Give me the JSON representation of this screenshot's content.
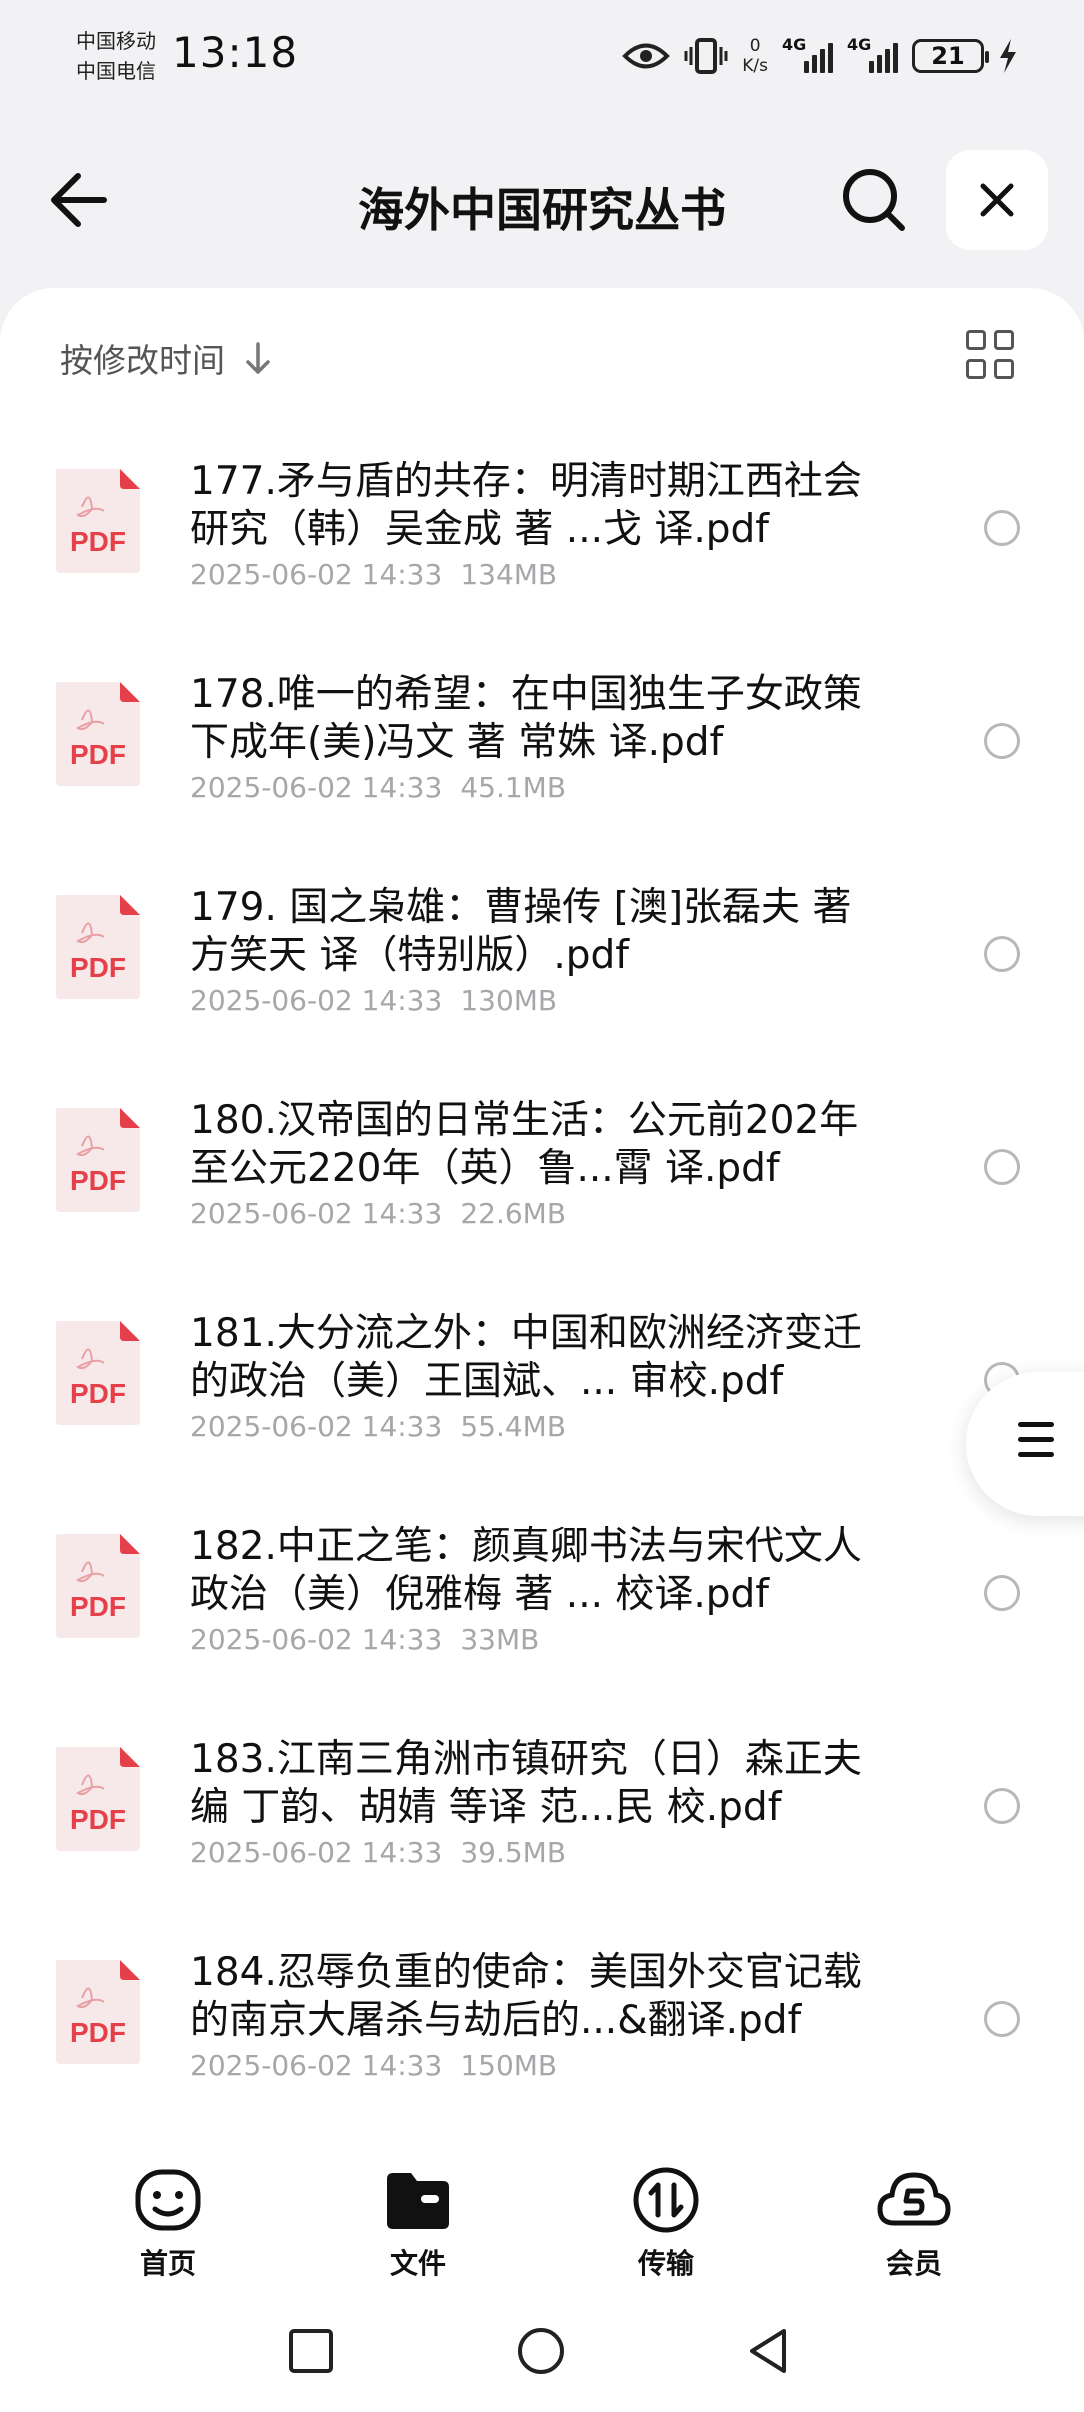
{
  "status_bar": {
    "carrier_1": "中国移动",
    "carrier_2": "中国电信",
    "time": "13:18",
    "net_speed_value": "0",
    "net_speed_unit": "K/s",
    "signal_1": "4G",
    "signal_2": "4G",
    "battery": "21"
  },
  "header": {
    "title": "海外中国研究丛书"
  },
  "sort": {
    "label": "按修改时间"
  },
  "files": [
    {
      "name": "177.矛与盾的共存：明清时期江西社会研究（韩）吴金成 著 ...戈 译.pdf",
      "date": "2025-06-02 14:33",
      "size": "134MB"
    },
    {
      "name": "178.唯一的希望：在中国独生子女政策下成年(美)冯文 著 常姝 译.pdf",
      "date": "2025-06-02 14:33",
      "size": "45.1MB"
    },
    {
      "name": "179. 国之枭雄：曹操传 [澳]张磊夫 著 方笑天 译（特别版）.pdf",
      "date": "2025-06-02 14:33",
      "size": "130MB"
    },
    {
      "name": "180.汉帝国的日常生活：公元前202年至公元220年（英）鲁...霄 译.pdf",
      "date": "2025-06-02 14:33",
      "size": "22.6MB"
    },
    {
      "name": "181.大分流之外：中国和欧洲经济变迁的政治（美）王国斌、... 审校.pdf",
      "date": "2025-06-02 14:33",
      "size": "55.4MB"
    },
    {
      "name": "182.中正之笔：颜真卿书法与宋代文人政治（美）倪雅梅 著 ... 校译.pdf",
      "date": "2025-06-02 14:33",
      "size": "33MB"
    },
    {
      "name": "183.江南三角洲市镇研究（日）森正夫 编 丁韵、胡婧 等译 范...民 校.pdf",
      "date": "2025-06-02 14:33",
      "size": "39.5MB"
    },
    {
      "name": "184.忍辱负重的使命：美国外交官记载的南京大屠杀与劫后的...&翻译.pdf",
      "date": "2025-06-02 14:33",
      "size": "150MB"
    }
  ],
  "pdf_badge": "PDF",
  "bottom_nav": {
    "home": "首页",
    "files": "文件",
    "transfer": "传输",
    "member": "会员"
  },
  "colors": {
    "pdf_red": "#e5404a",
    "pdf_bg": "#f7e9ea",
    "meta_gray": "#a7a7ab"
  }
}
